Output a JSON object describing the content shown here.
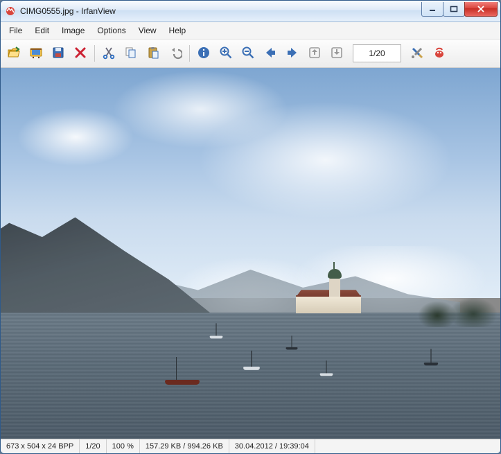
{
  "title": "CIMG0555.jpg - IrfanView",
  "menu": [
    "File",
    "Edit",
    "Image",
    "Options",
    "View",
    "Help"
  ],
  "toolbar": {
    "open": "open-icon",
    "slideshow": "slideshow-icon",
    "save": "save-icon",
    "delete": "delete-icon",
    "cut": "cut-icon",
    "copy": "copy-icon",
    "paste": "paste-icon",
    "undo": "undo-icon",
    "info": "info-icon",
    "zoom_in": "zoom-in-icon",
    "zoom_out": "zoom-out-icon",
    "prev": "prev-icon",
    "next": "next-icon",
    "first": "first-icon",
    "last": "last-icon",
    "index": "1/20",
    "settings": "settings-icon",
    "about": "about-icon"
  },
  "status": {
    "dims": "673 x 504 x 24 BPP",
    "index": "1/20",
    "zoom": "100 %",
    "size": "157.29 KB / 994.26 KB",
    "datetime": "30.04.2012 / 19:39:04"
  },
  "window_controls": {
    "min": "minimize",
    "max": "maximize",
    "close": "close"
  }
}
